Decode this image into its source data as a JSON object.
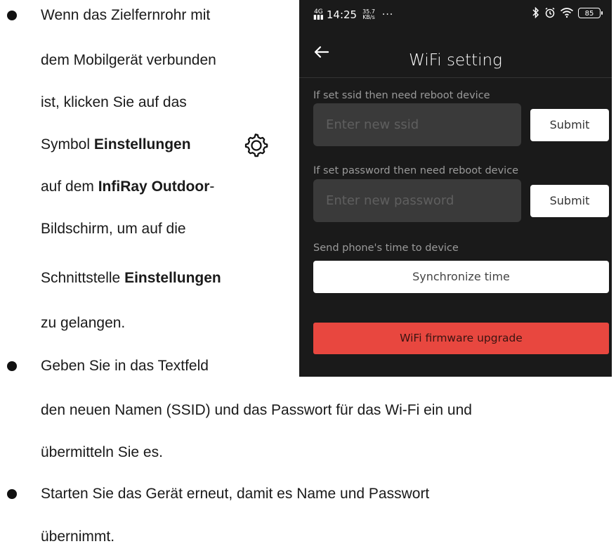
{
  "instructions": {
    "bullet1": {
      "line1": "Wenn das Zielfernrohr mit",
      "line2": "dem Mobilgerät verbunden",
      "line3": "ist, klicken Sie auf das",
      "line4_pre": "Symbol ",
      "line4_bold": "Einstellungen",
      "line5_pre": "auf dem ",
      "line5_bold": "InfiRay Outdoor",
      "line5_post": "-",
      "line6": "Bildschirm, um auf die",
      "line7_pre": "Schnittstelle ",
      "line7_bold": "Einstellungen",
      "line8": "zu gelangen."
    },
    "bullet2": {
      "line1": "Geben Sie in das Textfeld",
      "line2": "den neuen Namen (SSID) und das Passwort für das Wi-Fi ein und",
      "line3": "übermitteln Sie es."
    },
    "bullet3": {
      "line1": "Starten Sie das Gerät erneut, damit es Name und Passwort",
      "line2": "übernimmt."
    },
    "settings_icon": "gear-icon"
  },
  "phone": {
    "status": {
      "network": "4G",
      "time": "14:25",
      "speed_value": "35.7",
      "speed_unit": "KB/s",
      "dots": "···",
      "battery": "85",
      "icons": [
        "bluetooth-icon",
        "alarm-icon",
        "wifi-icon",
        "battery-icon"
      ]
    },
    "title": "WiFi setting",
    "ssid": {
      "label": "If set ssid then need reboot device",
      "placeholder": "Enter new ssid",
      "submit": "Submit"
    },
    "password": {
      "label": "If set password then need reboot device",
      "placeholder": "Enter new password",
      "submit": "Submit"
    },
    "time": {
      "label": "Send phone's time to device",
      "button": "Synchronize time"
    },
    "upgrade_button": "WiFi firmware upgrade",
    "colors": {
      "background": "#1a1a1a",
      "input": "#3a3a3a",
      "upgrade": "#e8473f"
    }
  }
}
